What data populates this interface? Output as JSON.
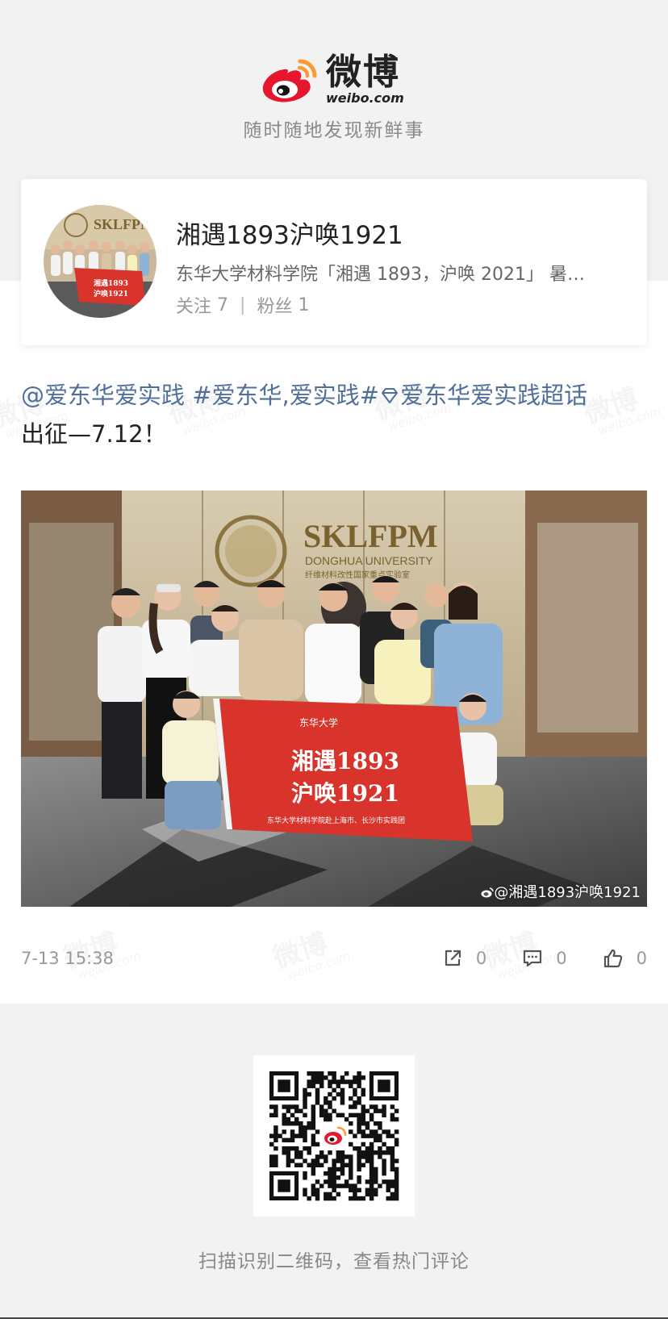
{
  "brand": {
    "name_cn": "微博",
    "domain": "weibo.com",
    "slogan": "随时随地发现新鲜事"
  },
  "profile": {
    "name": "湘遇1893沪唤1921",
    "description": "东华大学材料学院「湘遇 1893，沪唤 2021」 暑…",
    "following_label": "关注",
    "following_count": "7",
    "separator": "|",
    "followers_label": "粉丝",
    "followers_count": "1"
  },
  "post": {
    "mention": "@爱东华爱实践",
    "hashtag": "#爱东华,爱实践#",
    "supertopic": "爱东华爱实践超话",
    "text": "出征—7.12！",
    "photo_watermark": "@湘遇1893沪唤1921",
    "photo_text": {
      "banner_line1": "湘遇1893",
      "banner_line2": "沪唤1921",
      "banner_footer": "东华大学材料学院赴上海市、长沙市实践团",
      "university": "东华大学",
      "wall_sign": "SKLFPM",
      "wall_sub": "DONGHUA UNIVERSITY",
      "wall_cn": "纤维材料改性国家重点实验室"
    },
    "timestamp": "7-13 15:38",
    "shares": "0",
    "comments": "0",
    "likes": "0"
  },
  "footer": {
    "qr_caption": "扫描识别二维码，查看热门评论"
  },
  "colors": {
    "link": "#50709a",
    "brand_red": "#e6162d",
    "brand_orange": "#ff9933"
  }
}
